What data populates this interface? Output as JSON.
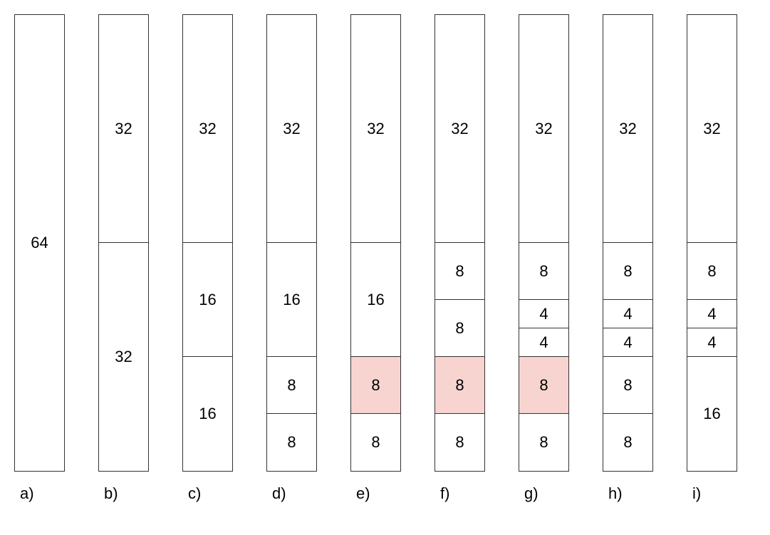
{
  "diagram": {
    "totalHeight": 640,
    "unitHeight": 10,
    "columns": [
      {
        "label": "a)",
        "blocks": [
          {
            "value": "64",
            "size": 64,
            "highlight": false
          }
        ]
      },
      {
        "label": "b)",
        "blocks": [
          {
            "value": "32",
            "size": 32,
            "highlight": false
          },
          {
            "value": "32",
            "size": 32,
            "highlight": false
          }
        ]
      },
      {
        "label": "c)",
        "blocks": [
          {
            "value": "32",
            "size": 32,
            "highlight": false
          },
          {
            "value": "16",
            "size": 16,
            "highlight": false
          },
          {
            "value": "16",
            "size": 16,
            "highlight": false
          }
        ]
      },
      {
        "label": "d)",
        "blocks": [
          {
            "value": "32",
            "size": 32,
            "highlight": false
          },
          {
            "value": "16",
            "size": 16,
            "highlight": false
          },
          {
            "value": "8",
            "size": 8,
            "highlight": false
          },
          {
            "value": "8",
            "size": 8,
            "highlight": false
          }
        ]
      },
      {
        "label": "e)",
        "blocks": [
          {
            "value": "32",
            "size": 32,
            "highlight": false
          },
          {
            "value": "16",
            "size": 16,
            "highlight": false
          },
          {
            "value": "8",
            "size": 8,
            "highlight": true
          },
          {
            "value": "8",
            "size": 8,
            "highlight": false
          }
        ]
      },
      {
        "label": "f)",
        "blocks": [
          {
            "value": "32",
            "size": 32,
            "highlight": false
          },
          {
            "value": "8",
            "size": 8,
            "highlight": false
          },
          {
            "value": "8",
            "size": 8,
            "highlight": false
          },
          {
            "value": "8",
            "size": 8,
            "highlight": true
          },
          {
            "value": "8",
            "size": 8,
            "highlight": false
          }
        ]
      },
      {
        "label": "g)",
        "blocks": [
          {
            "value": "32",
            "size": 32,
            "highlight": false
          },
          {
            "value": "8",
            "size": 8,
            "highlight": false
          },
          {
            "value": "4",
            "size": 4,
            "highlight": false
          },
          {
            "value": "4",
            "size": 4,
            "highlight": false
          },
          {
            "value": "8",
            "size": 8,
            "highlight": true
          },
          {
            "value": "8",
            "size": 8,
            "highlight": false
          }
        ]
      },
      {
        "label": "h)",
        "blocks": [
          {
            "value": "32",
            "size": 32,
            "highlight": false
          },
          {
            "value": "8",
            "size": 8,
            "highlight": false
          },
          {
            "value": "4",
            "size": 4,
            "highlight": false
          },
          {
            "value": "4",
            "size": 4,
            "highlight": false
          },
          {
            "value": "8",
            "size": 8,
            "highlight": false
          },
          {
            "value": "8",
            "size": 8,
            "highlight": false
          }
        ]
      },
      {
        "label": "i)",
        "blocks": [
          {
            "value": "32",
            "size": 32,
            "highlight": false
          },
          {
            "value": "8",
            "size": 8,
            "highlight": false
          },
          {
            "value": "4",
            "size": 4,
            "highlight": false
          },
          {
            "value": "4",
            "size": 4,
            "highlight": false
          },
          {
            "value": "16",
            "size": 16,
            "highlight": false
          }
        ]
      }
    ]
  }
}
